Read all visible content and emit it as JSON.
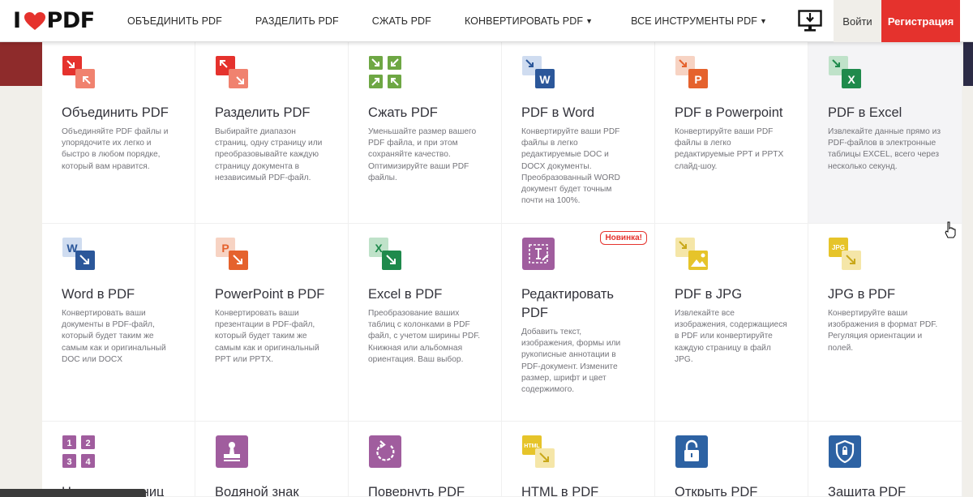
{
  "logo": {
    "prefix": "I",
    "suffix": "PDF",
    "heart_color": "#e5322d"
  },
  "nav": {
    "items": [
      {
        "label": "ОБЪЕДИНИТЬ PDF",
        "dropdown": false
      },
      {
        "label": "РАЗДЕЛИТЬ PDF",
        "dropdown": false
      },
      {
        "label": "СЖАТЬ PDF",
        "dropdown": false
      },
      {
        "label": "КОНВЕРТИРОВАТЬ PDF",
        "dropdown": true
      },
      {
        "label": "ВСЕ ИНСТРУМЕНТЫ PDF",
        "dropdown": true
      }
    ],
    "caret": "▼"
  },
  "header_actions": {
    "desktop_icon": "desktop-download-icon",
    "login_label": "Войти",
    "signup_label": "Регистрация",
    "signup_color": "#e5322d"
  },
  "tools": [
    {
      "title": "Объединить PDF",
      "desc": "Объединяйте PDF файлы и упорядочите их легко и быстро в любом порядке, который вам нравится.",
      "icon": "merge-icon",
      "color": "#e5322d"
    },
    {
      "title": "Разделить PDF",
      "desc": "Выбирайте диапазон страниц, одну страницу или преобразовывайте каждую страницу документа в независимый PDF-файл.",
      "icon": "split-icon",
      "color": "#e5322d"
    },
    {
      "title": "Сжать PDF",
      "desc": "Уменьшайте размер вашего PDF файла, и при этом сохраняйте качество. Оптимизируйте ваши PDF файлы.",
      "icon": "compress-icon",
      "color": "#6ea744"
    },
    {
      "title": "PDF в Word",
      "desc": "Конвертируйте ваши PDF файлы в легко редактируемые DOC и DOCX документы. Преобразованный WORD документ будет точным почти на 100%.",
      "icon": "pdf-to-word-icon",
      "color": "#2b579a",
      "letter": "W"
    },
    {
      "title": "PDF в Powerpoint",
      "desc": "Конвертируйте ваши PDF файлы в легко редактируемые PPT и PPTX слайд-шоу.",
      "icon": "pdf-to-powerpoint-icon",
      "color": "#e5622d",
      "letter": "P"
    },
    {
      "title": "PDF в Excel",
      "desc": "Извлекайте данные прямо из PDF-файлов в электронные таблицы EXCEL, всего через несколько секунд.",
      "icon": "pdf-to-excel-icon",
      "color": "#1f8a4c",
      "letter": "X"
    },
    {
      "title": "Word в PDF",
      "desc": "Конвертировать ваши документы в PDF-файл, который будет таким же самым как и оригинальный DOC или DOCX",
      "icon": "word-to-pdf-icon",
      "color": "#2b579a",
      "letter": "W"
    },
    {
      "title": "PowerPoint в PDF",
      "desc": "Конвертировать ваши презентации в PDF-файл, который будет таким же самым как и оригинальный PPT или PPTX.",
      "icon": "powerpoint-to-pdf-icon",
      "color": "#e5622d",
      "letter": "P"
    },
    {
      "title": "Excel в PDF",
      "desc": "Преобразование ваших таблиц с колонками в PDF файл, с учетом ширины PDF. Книжная или альбомная ориентация. Ваш выбор.",
      "icon": "excel-to-pdf-icon",
      "color": "#1f8a4c",
      "letter": "X"
    },
    {
      "title": "Редактировать PDF",
      "desc": "Добавить текст, изображения, формы или рукописные аннотации в PDF-документ. Измените размер, шрифт и цвет содержимого.",
      "icon": "edit-pdf-icon",
      "color": "#a05d9e",
      "badge": "Новинка!"
    },
    {
      "title": "PDF в JPG",
      "desc": "Извлекайте все изображения, содержащиеся в PDF или конвертируйте каждую страницу в файл JPG.",
      "icon": "pdf-to-jpg-icon",
      "color": "#e6c42a"
    },
    {
      "title": "JPG в PDF",
      "desc": "Конвертируйте ваши изображения в формат PDF. Регуляция ориентации и полей.",
      "icon": "jpg-to-pdf-icon",
      "color": "#e6c42a",
      "letter": "JPG"
    },
    {
      "title": "Номера страниц",
      "desc": "",
      "icon": "page-numbers-icon",
      "color": "#a05d9e",
      "digits": [
        "1",
        "2",
        "3",
        "4"
      ]
    },
    {
      "title": "Водяной знак",
      "desc": "",
      "icon": "watermark-icon",
      "color": "#a05d9e"
    },
    {
      "title": "Повернуть PDF",
      "desc": "",
      "icon": "rotate-icon",
      "color": "#a05d9e"
    },
    {
      "title": "HTML в PDF",
      "desc": "",
      "icon": "html-to-pdf-icon",
      "color": "#e6c42a",
      "letter": "HTML"
    },
    {
      "title": "Открыть PDF",
      "desc": "",
      "icon": "unlock-icon",
      "color": "#2d62a3"
    },
    {
      "title": "Защита PDF",
      "desc": "",
      "icon": "protect-shield-icon",
      "color": "#2d62a3"
    }
  ]
}
